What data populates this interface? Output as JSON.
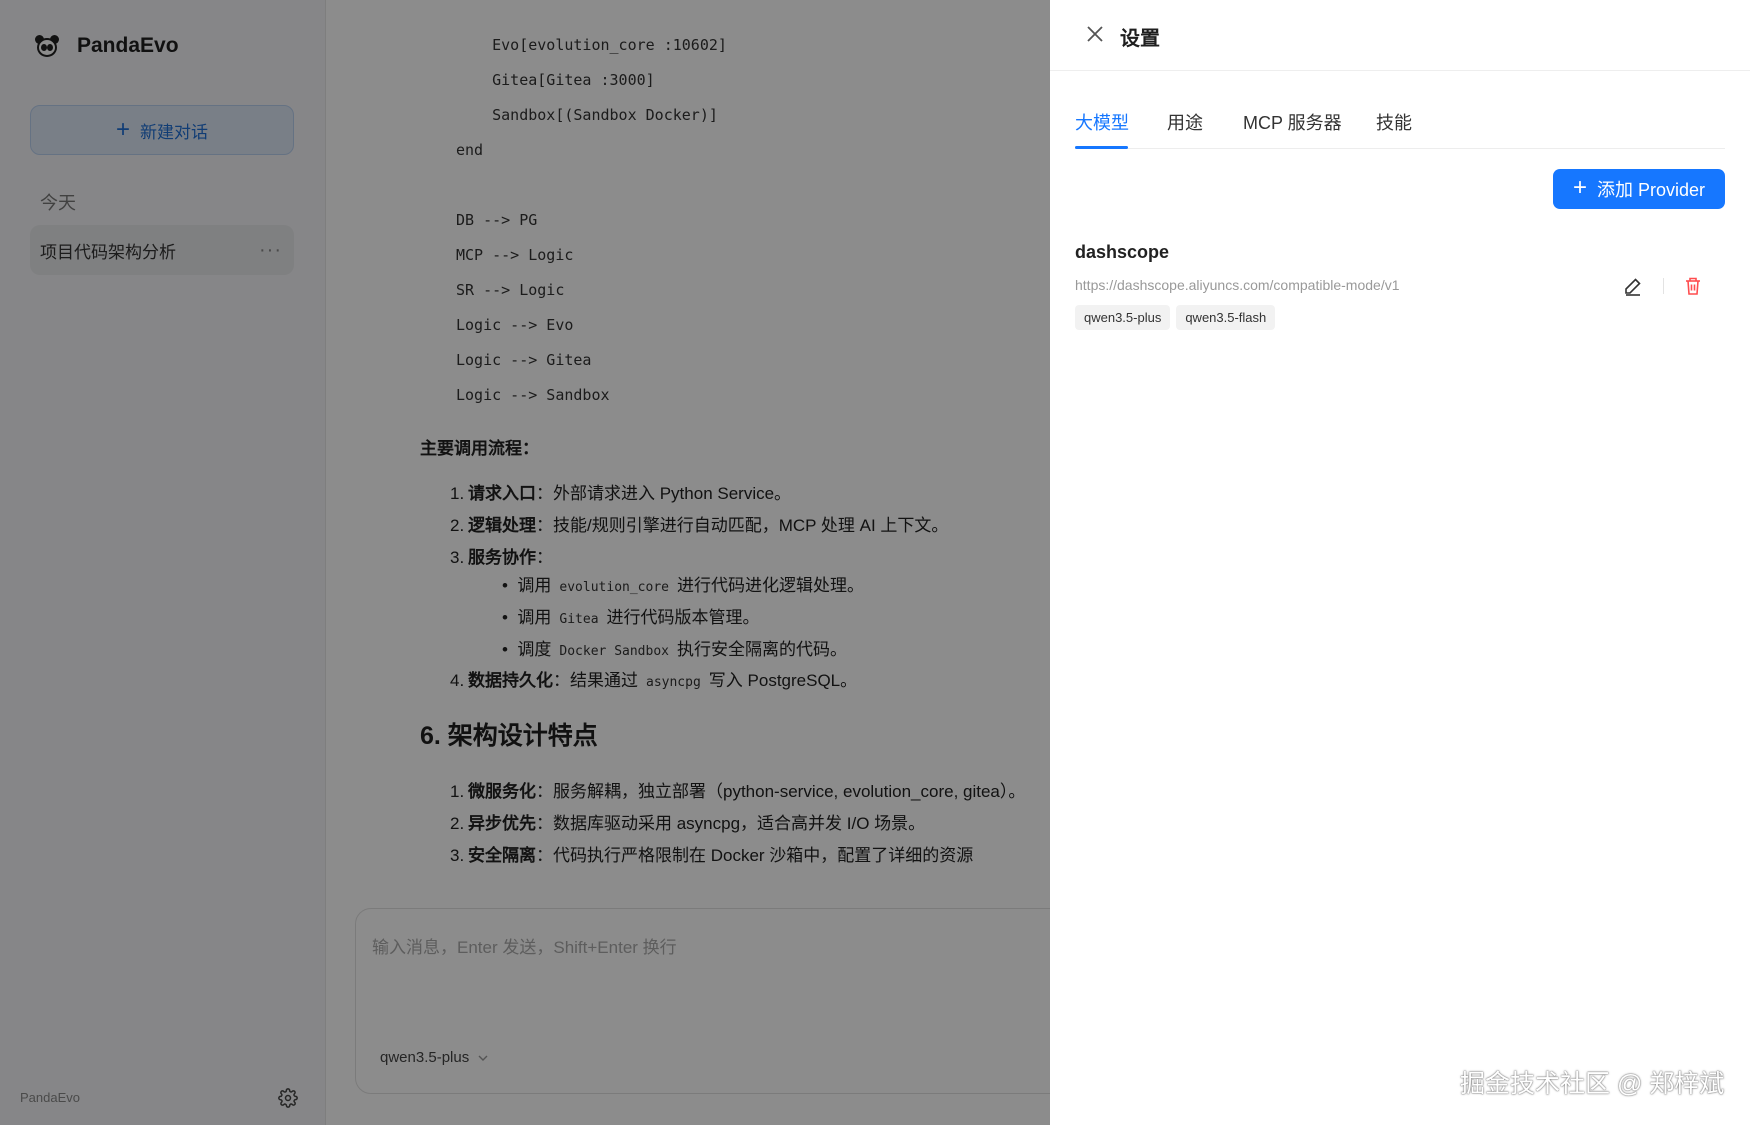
{
  "sidebar": {
    "brand": "PandaEvo",
    "new_chat_label": "新建对话",
    "section_today": "今天",
    "chat_items": [
      {
        "title": "项目代码架构分析",
        "more": "···"
      }
    ],
    "footer_name": "PandaEvo"
  },
  "main": {
    "code_lines": [
      "    Evo[evolution_core :10602]",
      "    Gitea[Gitea :3000]",
      "    Sandbox[(Sandbox Docker)]",
      "end",
      "DB --> PG",
      "MCP --> Logic",
      "SR --> Logic",
      "Logic --> Evo",
      "Logic --> Gitea",
      "Logic --> Sandbox"
    ],
    "flow_heading": "主要调用流程：",
    "flow": [
      {
        "num": "1.",
        "bold": "请求入口",
        "text": "：外部请求进入 Python Service。"
      },
      {
        "num": "2.",
        "bold": "逻辑处理",
        "text": "：技能/规则引擎进行自动匹配，MCP 处理 AI 上下文。"
      },
      {
        "num": "3.",
        "bold": "服务协作",
        "text": "："
      },
      {
        "num": "4.",
        "bold": "数据持久化",
        "text_before": "：结果通过",
        "code": "asyncpg",
        "text_after": "写入 PostgreSQL。"
      }
    ],
    "sub_bullets": [
      {
        "before": "调用",
        "code": "evolution_core",
        "after": "进行代码进化逻辑处理。"
      },
      {
        "before": "调用",
        "code": "Gitea",
        "after": "进行代码版本管理。"
      },
      {
        "before": "调度",
        "code": "Docker Sandbox",
        "after": "执行安全隔离的代码。"
      }
    ],
    "section_heading": "6. 架构设计特点",
    "features": [
      {
        "num": "1.",
        "bold": "微服务化",
        "text": "：服务解耦，独立部署（python-service, evolution_core, gitea）。"
      },
      {
        "num": "2.",
        "bold": "异步优先",
        "text": "：数据库驱动采用 asyncpg，适合高并发 I/O 场景。"
      },
      {
        "num": "3.",
        "bold": "安全隔离",
        "text": "：代码执行严格限制在 Docker 沙箱中，配置了详细的资源"
      }
    ],
    "input_placeholder": "输入消息，Enter 发送，Shift+Enter 换行",
    "model_selected": "qwen3.5-plus"
  },
  "settings": {
    "title": "设置",
    "tabs": [
      "大模型",
      "用途",
      "MCP 服务器",
      "技能"
    ],
    "active_tab": "大模型",
    "add_provider_label": "添加 Provider",
    "providers": [
      {
        "name": "dashscope",
        "url": "https://dashscope.aliyuncs.com/compatible-mode/v1",
        "models": [
          "qwen3.5-plus",
          "qwen3.5-flash"
        ]
      }
    ]
  },
  "watermark": "掘金技术社区 @ 郑梓斌",
  "colors": {
    "accent": "#1677ff",
    "danger": "#ff4d4f"
  },
  "icons": [
    "panda-logo-icon",
    "plus-icon",
    "more-icon",
    "gear-icon",
    "chevron-down-icon",
    "close-icon",
    "edit-icon",
    "trash-icon"
  ]
}
